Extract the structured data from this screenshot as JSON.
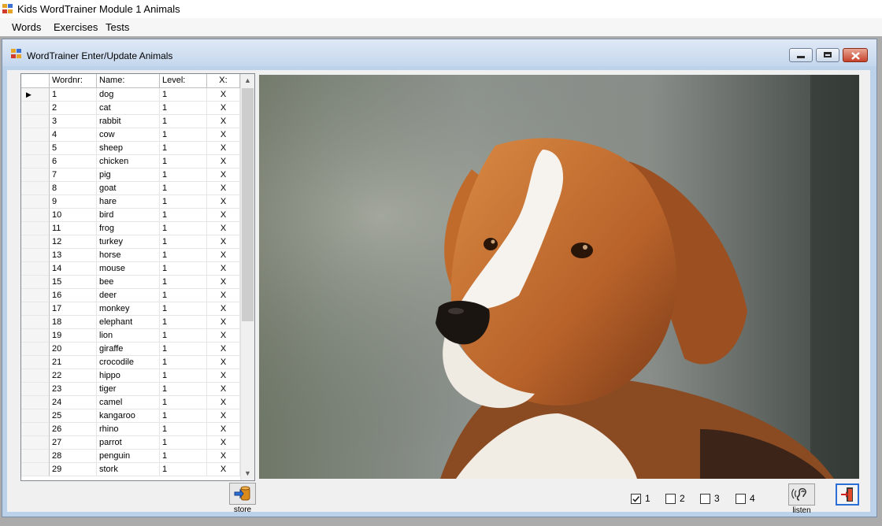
{
  "app": {
    "title": "Kids WordTrainer Module 1 Animals",
    "menu": [
      "Words",
      "Exercises",
      "Tests"
    ]
  },
  "child": {
    "title": "WordTrainer Enter/Update  Animals"
  },
  "grid": {
    "headers": [
      "Wordnr:",
      "Name:",
      "Level:",
      "X:"
    ],
    "rows": [
      [
        "1",
        "dog",
        "1",
        "X"
      ],
      [
        "2",
        "cat",
        "1",
        "X"
      ],
      [
        "3",
        "rabbit",
        "1",
        "X"
      ],
      [
        "4",
        "cow",
        "1",
        "X"
      ],
      [
        "5",
        "sheep",
        "1",
        "X"
      ],
      [
        "6",
        "chicken",
        "1",
        "X"
      ],
      [
        "7",
        "pig",
        "1",
        "X"
      ],
      [
        "8",
        "goat",
        "1",
        "X"
      ],
      [
        "9",
        "hare",
        "1",
        "X"
      ],
      [
        "10",
        "bird",
        "1",
        "X"
      ],
      [
        "11",
        "frog",
        "1",
        "X"
      ],
      [
        "12",
        "turkey",
        "1",
        "X"
      ],
      [
        "13",
        "horse",
        "1",
        "X"
      ],
      [
        "14",
        "mouse",
        "1",
        "X"
      ],
      [
        "15",
        "bee",
        "1",
        "X"
      ],
      [
        "16",
        "deer",
        "1",
        "X"
      ],
      [
        "17",
        "monkey",
        "1",
        "X"
      ],
      [
        "18",
        "elephant",
        "1",
        "X"
      ],
      [
        "19",
        "lion",
        "1",
        "X"
      ],
      [
        "20",
        "giraffe",
        "1",
        "X"
      ],
      [
        "21",
        "crocodile",
        "1",
        "X"
      ],
      [
        "22",
        "hippo",
        "1",
        "X"
      ],
      [
        "23",
        "tiger",
        "1",
        "X"
      ],
      [
        "24",
        "camel",
        "1",
        "X"
      ],
      [
        "25",
        "kangaroo",
        "1",
        "X"
      ],
      [
        "26",
        "rhino",
        "1",
        "X"
      ],
      [
        "27",
        "parrot",
        "1",
        "X"
      ],
      [
        "28",
        "penguin",
        "1",
        "X"
      ],
      [
        "29",
        "stork",
        "1",
        "X"
      ]
    ],
    "current_row_marker": "▶"
  },
  "bottom": {
    "store_label": "store",
    "listen_label": "listen",
    "levels": [
      {
        "label": "1",
        "checked": true
      },
      {
        "label": "2",
        "checked": false
      },
      {
        "label": "3",
        "checked": false
      },
      {
        "label": "4",
        "checked": false
      }
    ]
  },
  "icons": {
    "app_icon": "app-icon",
    "store": "store-database-icon",
    "listen": "ear-icon",
    "exit": "exit-door-icon"
  },
  "colors": {
    "title_gradient_top": "#dfe9f5",
    "close_button": "#c7432b",
    "dog_fur": "#b8622a"
  }
}
